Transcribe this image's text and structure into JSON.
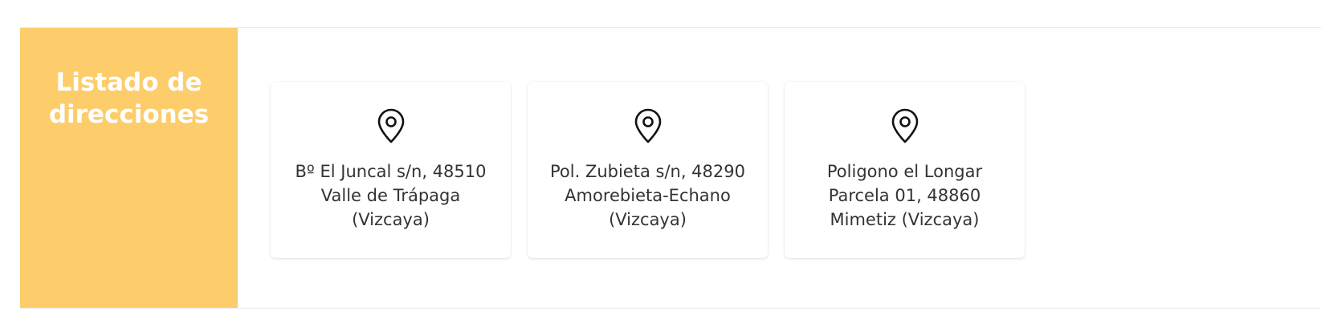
{
  "section": {
    "title_line1": "Listado de",
    "title_line2": "direcciones"
  },
  "addresses": [
    {
      "icon": "map-pin-icon",
      "lines": [
        "Bº El Juncal s/n, 48510",
        "Valle de Trápaga",
        "(Vizcaya)"
      ]
    },
    {
      "icon": "map-pin-icon",
      "lines": [
        "Pol. Zubieta s/n, 48290",
        "Amorebieta-Echano",
        "(Vizcaya)"
      ]
    },
    {
      "icon": "map-pin-icon",
      "lines": [
        "Poligono el Longar",
        "Parcela 01, 48860",
        "Mimetiz (Vizcaya)"
      ]
    }
  ],
  "colors": {
    "sidebar_bg": "#fccd6a",
    "sidebar_text": "#ffffff",
    "card_text": "#333333"
  }
}
